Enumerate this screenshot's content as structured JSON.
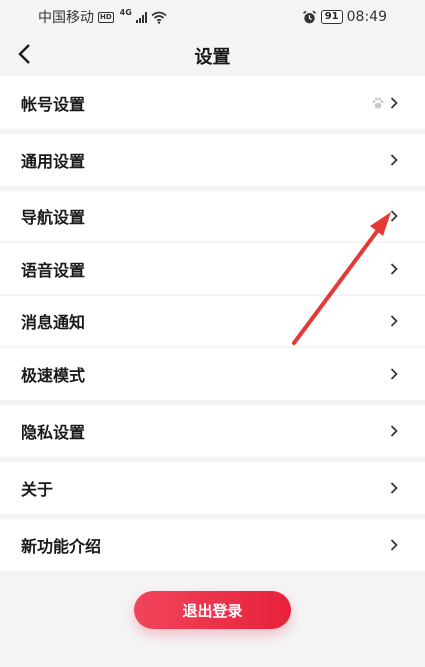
{
  "status_bar": {
    "carrier": "中国移动",
    "network_badge": "HD",
    "network_type": "4G",
    "battery_level": "91",
    "time": "08:49"
  },
  "header": {
    "title": "设置"
  },
  "menu": [
    {
      "label": "帐号设置",
      "icon": "paw-icon"
    },
    {
      "label": "通用设置"
    },
    {
      "label": "导航设置"
    },
    {
      "label": "语音设置"
    },
    {
      "label": "消息通知"
    },
    {
      "label": "极速模式"
    },
    {
      "label": "隐私设置"
    },
    {
      "label": "关于"
    },
    {
      "label": "新功能介绍"
    }
  ],
  "logout": {
    "label": "退出登录"
  },
  "colors": {
    "accent_red": "#e8213a",
    "annotation_arrow": "#e53935",
    "background": "#f4f4f6"
  }
}
